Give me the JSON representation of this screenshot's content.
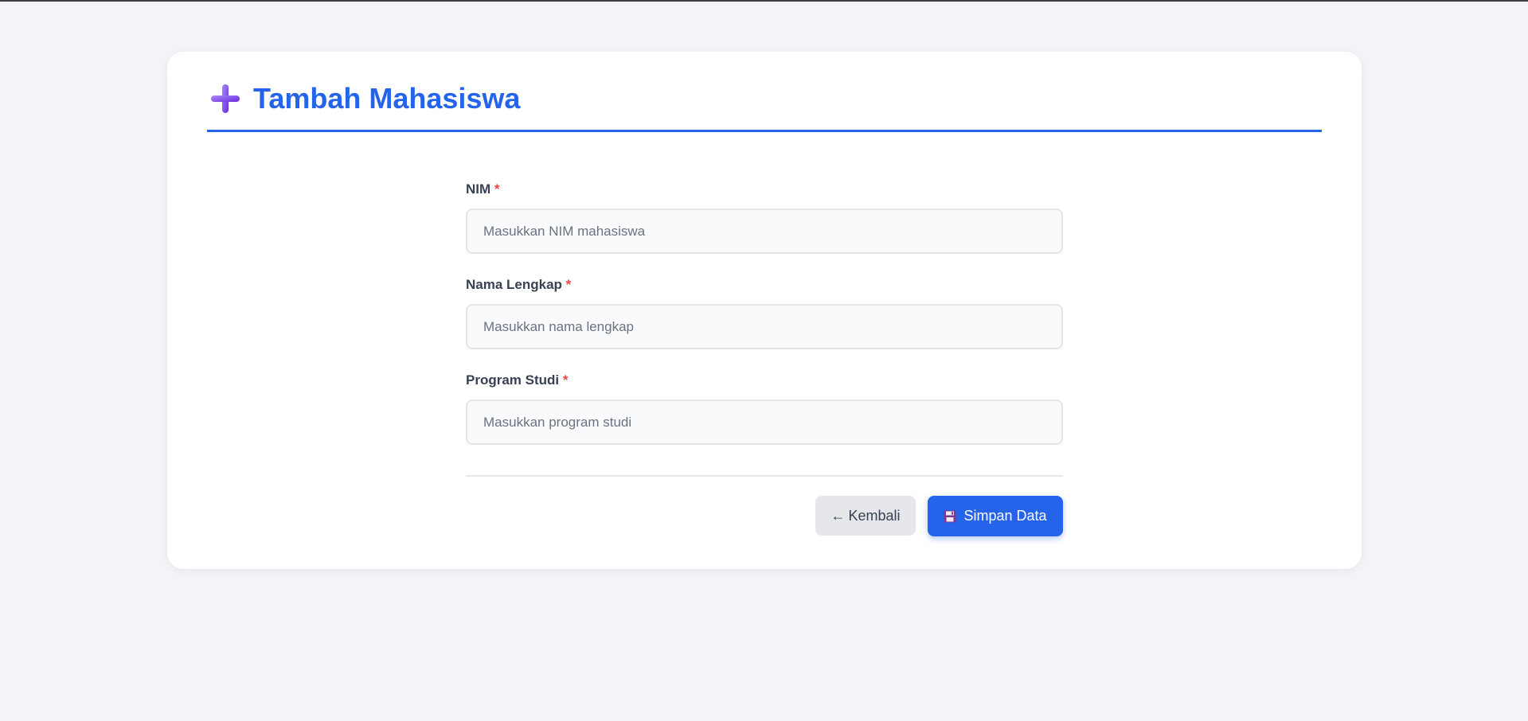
{
  "page": {
    "title": "Tambah Mahasiswa"
  },
  "icons": {
    "title_icon": "plus-icon",
    "back_icon": "arrow-left-icon",
    "save_icon": "floppy-disk-icon"
  },
  "colors": {
    "accent": "#2563eb",
    "plus_icon": "#8b5cf6",
    "required": "#ef4444",
    "background": "#f3f4f8"
  },
  "form": {
    "fields": [
      {
        "label": "NIM",
        "required_mark": "*",
        "placeholder": "Masukkan NIM mahasiswa",
        "value": ""
      },
      {
        "label": "Nama Lengkap",
        "required_mark": "*",
        "placeholder": "Masukkan nama lengkap",
        "value": ""
      },
      {
        "label": "Program Studi",
        "required_mark": "*",
        "placeholder": "Masukkan program studi",
        "value": ""
      }
    ]
  },
  "actions": {
    "back_arrow": "←",
    "back_label": "Kembali",
    "save_label": "Simpan Data"
  }
}
